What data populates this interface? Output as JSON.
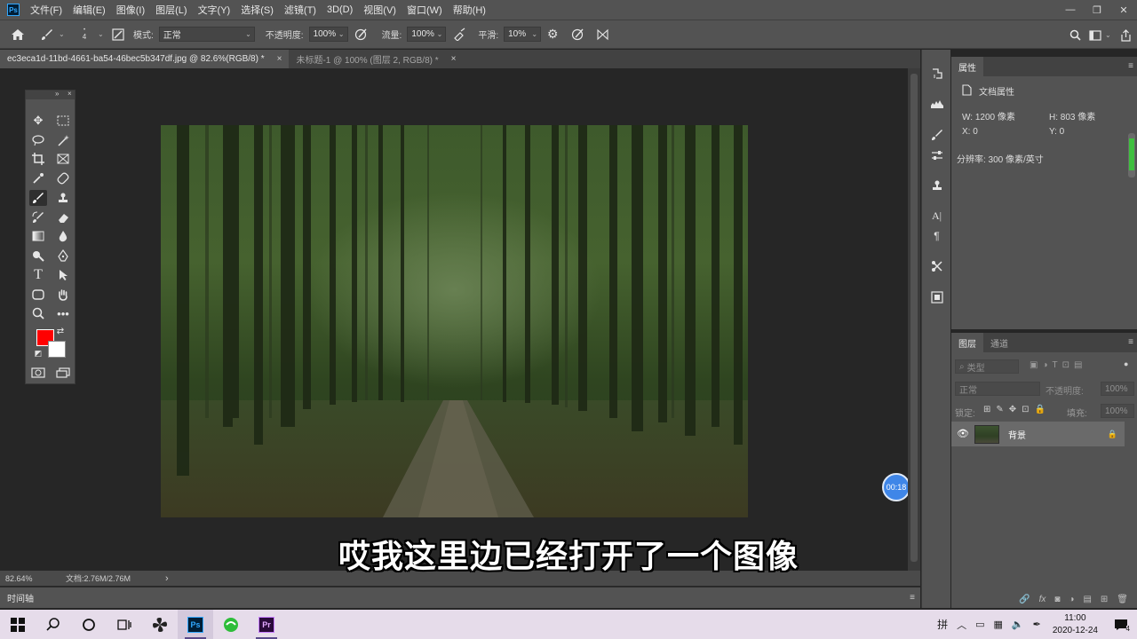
{
  "menu": {
    "items": [
      "文件(F)",
      "编辑(E)",
      "图像(I)",
      "图层(L)",
      "文字(Y)",
      "选择(S)",
      "滤镜(T)",
      "3D(D)",
      "视图(V)",
      "窗口(W)",
      "帮助(H)"
    ],
    "app_logo": "Ps"
  },
  "options": {
    "brush_size": "4",
    "mode_label": "模式:",
    "mode_value": "正常",
    "opacity_label": "不透明度:",
    "opacity_value": "100%",
    "flow_label": "流量:",
    "flow_value": "100%",
    "smooth_label": "平滑:",
    "smooth_value": "10%"
  },
  "tabs": [
    {
      "label": "ec3eca1d-11bd-4661-ba54-46bec5b347df.jpg @ 82.6%(RGB/8) *",
      "close": "×"
    },
    {
      "label": "未标题-1 @ 100% (图层 2, RGB/8) *",
      "close": "×"
    }
  ],
  "status": {
    "zoom": "82.64%",
    "doc": "文档:2.76M/2.76M",
    "arrow": "›"
  },
  "timeline": {
    "label": "时间轴"
  },
  "properties": {
    "tabs": [
      "属性"
    ],
    "doc_props": "文档属性",
    "w": "W:  1200 像素",
    "h": "H:  803 像素",
    "x": "X:  0",
    "y": "Y:  0",
    "resolution": "分辨率: 300 像素/英寸"
  },
  "layers": {
    "tabs": [
      "图层",
      "通道"
    ],
    "search_placeholder": "类型",
    "blend_mode": "正常",
    "opacity_label": "不透明度:",
    "opacity_value": "100%",
    "lock_label": "锁定:",
    "fill_label": "填充:",
    "fill_value": "100%",
    "layer_name": "背景",
    "footer_icons": [
      "🔗",
      "fx",
      "◙",
      "◑",
      "▤",
      "⊞",
      "🗑"
    ]
  },
  "subtitle": "哎我这里边已经打开了一个图像",
  "recording_timer": "00:18",
  "taskbar": {
    "apps": [
      "Ps",
      "Pr"
    ],
    "input_method": "拼",
    "time": "11:00",
    "date": "2020-12-24",
    "notification_count": "4"
  },
  "colors": {
    "foreground": "#ff0000",
    "background": "#ffffff",
    "ui_panel": "#535353",
    "canvas_bg": "#262626"
  }
}
